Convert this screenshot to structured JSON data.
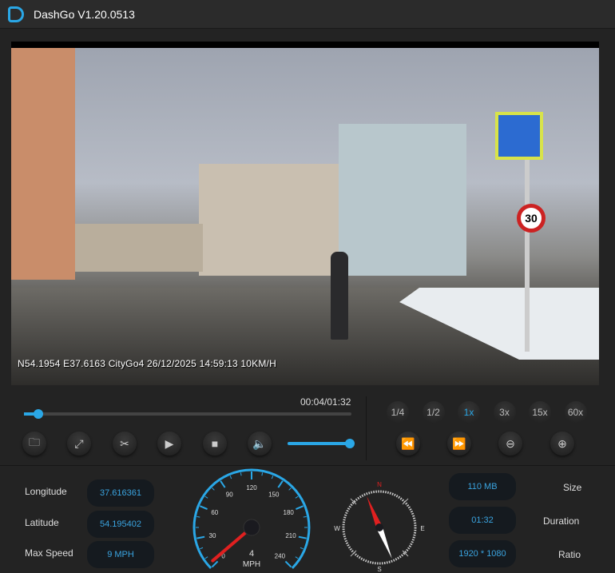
{
  "app": {
    "title": "DashGo V1.20.0513"
  },
  "video": {
    "osd": "N54.1954 E37.6163  CityGo4 26/12/2025 14:59:13 10KM/H",
    "sign_speed": "30"
  },
  "player": {
    "time": "00:04/01:32",
    "progress": 0.043,
    "volume": 1.0,
    "speeds": [
      {
        "label": "1/4"
      },
      {
        "label": "1/2"
      },
      {
        "label": "1x",
        "active": true
      },
      {
        "label": "3x"
      },
      {
        "label": "15x"
      },
      {
        "label": "60x"
      }
    ]
  },
  "info": {
    "longitude_label": "Longitude",
    "longitude": "37.616361",
    "latitude_label": "Latitude",
    "latitude": "54.195402",
    "max_speed_label": "Max Speed",
    "max_speed": "9 MPH",
    "size_label": "Size",
    "size": "110 MB",
    "duration_label": "Duration",
    "duration": "01:32",
    "ratio_label": "Ratio",
    "ratio": "1920 * 1080"
  },
  "speedometer": {
    "value": "4",
    "speed": 4,
    "unit": "MPH",
    "ticks": [
      "0",
      "30",
      "60",
      "90",
      "120",
      "150",
      "180",
      "210",
      "240"
    ]
  },
  "compass": {
    "n": "N",
    "e": "E",
    "s": "S",
    "w": "W",
    "heading_deg": -22
  },
  "colors": {
    "accent": "#2aa7e6",
    "needle": "#e02020"
  }
}
